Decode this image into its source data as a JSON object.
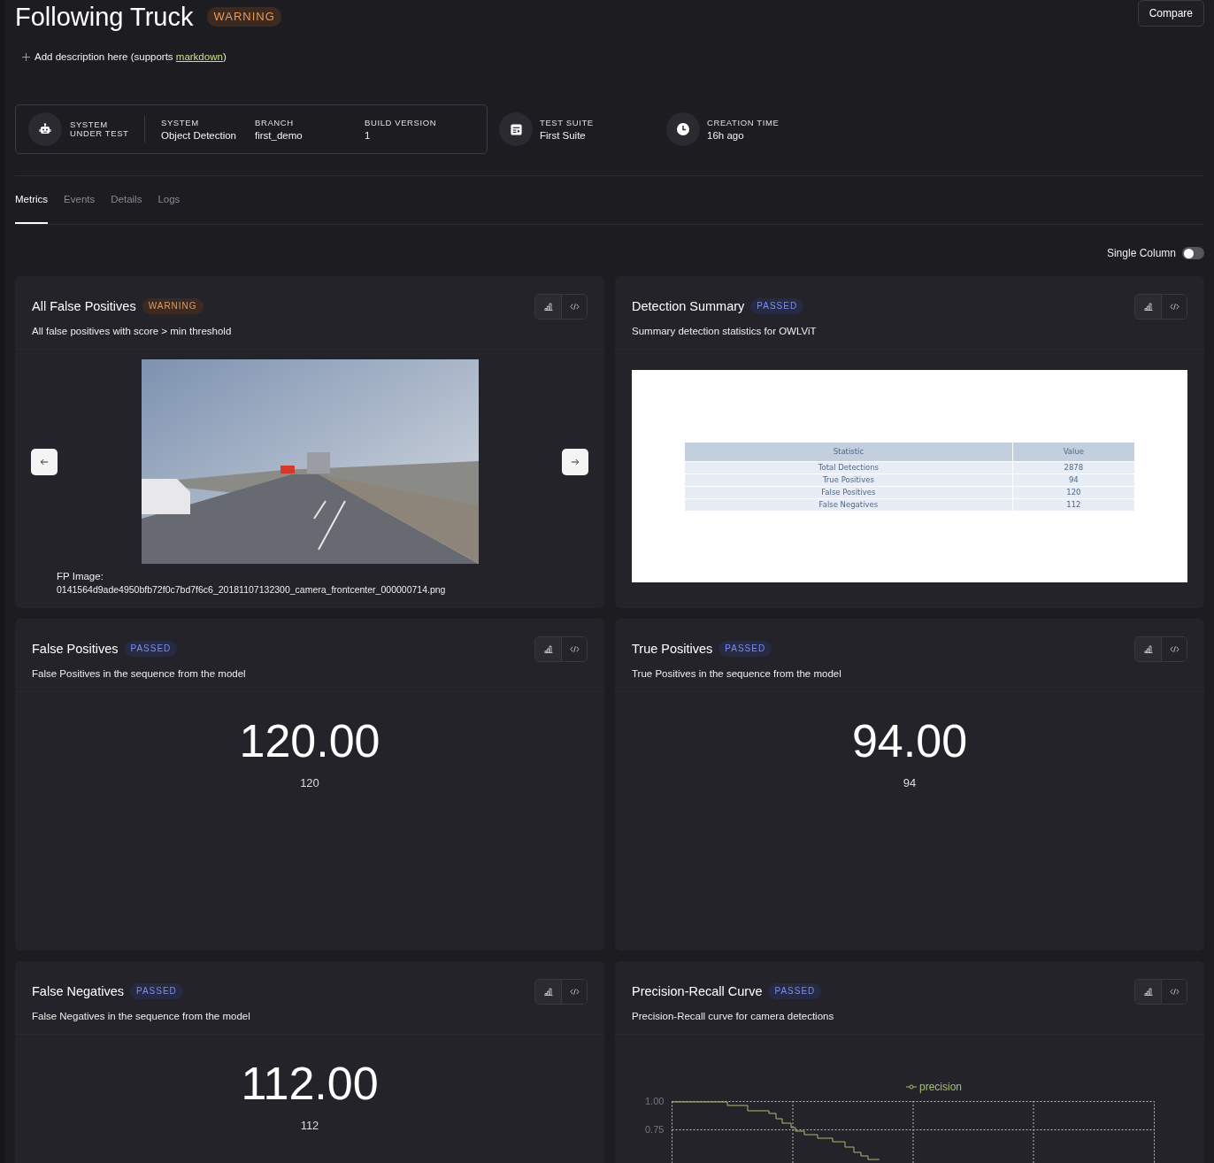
{
  "title": "Following Truck",
  "status": {
    "label": "WARNING",
    "kind": "warning"
  },
  "compare_button": "Compare",
  "description": {
    "before": "Add description here (supports ",
    "link": "markdown",
    "after": ")"
  },
  "system_under_test": {
    "label_lines": [
      "SYSTEM",
      "UNDER TEST"
    ],
    "fields": [
      {
        "label": "SYSTEM",
        "value": "Object Detection"
      },
      {
        "label": "BRANCH",
        "value": "first_demo"
      },
      {
        "label": "BUILD VERSION",
        "value": "1"
      }
    ]
  },
  "meta": [
    {
      "kind": "suite",
      "label": "TEST SUITE",
      "value": "First Suite"
    },
    {
      "kind": "time",
      "label": "CREATION TIME",
      "value": "16h ago"
    }
  ],
  "tabs": [
    {
      "label": "Metrics",
      "selected": true
    },
    {
      "label": "Events",
      "selected": false
    },
    {
      "label": "Details",
      "selected": false
    },
    {
      "label": "Logs",
      "selected": false
    }
  ],
  "single_column": {
    "label": "Single Column",
    "on": false
  },
  "cards": [
    {
      "kind": "image",
      "title": "All False Positives",
      "status": {
        "label": "WARNING",
        "kind": "warning"
      },
      "description": "All false positives with score > min threshold",
      "caption_label": "FP Image:",
      "caption_value": "0141564d9ade4950bfb72f0c7bd7f6c6_20181107132300_camera_frontcenter_000000714.png"
    },
    {
      "kind": "table",
      "title": "Detection Summary",
      "status": {
        "label": "PASSED",
        "kind": "passed"
      },
      "description": "Summary detection statistics for OWLViT",
      "columns": [
        "Statistic",
        "Value"
      ],
      "rows": [
        [
          "Total Detections",
          "2878"
        ],
        [
          "True Positives",
          "94"
        ],
        [
          "False Positives",
          "120"
        ],
        [
          "False Negatives",
          "112"
        ]
      ]
    },
    {
      "kind": "metric",
      "title": "False Positives",
      "status": {
        "label": "PASSED",
        "kind": "passed"
      },
      "description": "False Positives in the sequence from the model",
      "value": "120.00",
      "subvalue": "120"
    },
    {
      "kind": "metric",
      "title": "True Positives",
      "status": {
        "label": "PASSED",
        "kind": "passed"
      },
      "description": "True Positives in the sequence from the model",
      "value": "94.00",
      "subvalue": "94"
    },
    {
      "kind": "metric",
      "title": "False Negatives",
      "status": {
        "label": "PASSED",
        "kind": "passed"
      },
      "description": "False Negatives in the sequence from the model",
      "value": "112.00",
      "subvalue": "112"
    },
    {
      "kind": "curve",
      "title": "Precision-Recall Curve",
      "status": {
        "label": "PASSED",
        "kind": "passed"
      },
      "description": "Precision-Recall curve for camera detections",
      "legend": "precision",
      "ytick_labels": [
        "1.00",
        "0.75"
      ]
    }
  ]
}
